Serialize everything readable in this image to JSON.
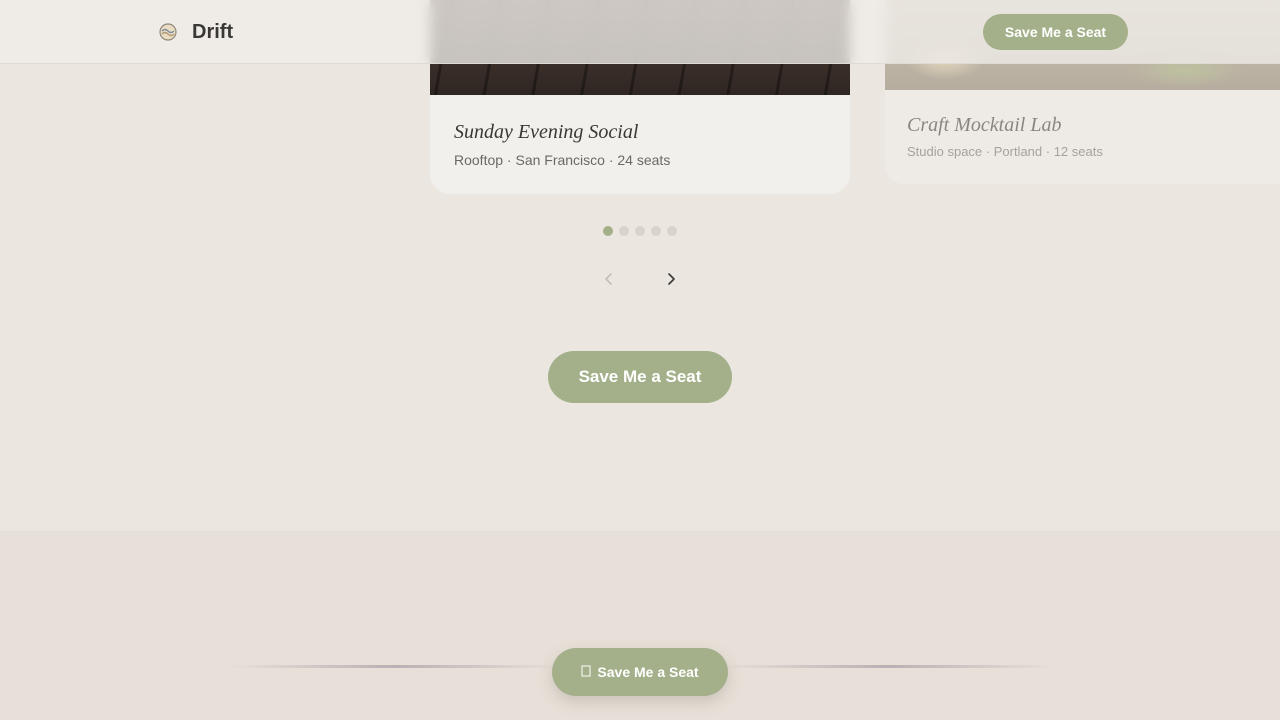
{
  "header": {
    "brand": "Drift",
    "cta_label": "Save Me a Seat"
  },
  "carousel": {
    "cards": [
      {
        "title": "Sunday Evening Social",
        "meta": "Rooftop · San Francisco · 24 seats"
      },
      {
        "title": "Craft Mocktail Lab",
        "meta": "Studio space · Portland · 12 seats"
      }
    ],
    "page_count": 5,
    "active_page": 1
  },
  "main": {
    "cta_label": "Save Me a Seat"
  },
  "floating": {
    "cta_label": "Save Me a Seat",
    "icon": "ticket-icon"
  },
  "colors": {
    "accent": "#a3b08a",
    "background": "#ebe6e0",
    "text": "#3a3835"
  }
}
